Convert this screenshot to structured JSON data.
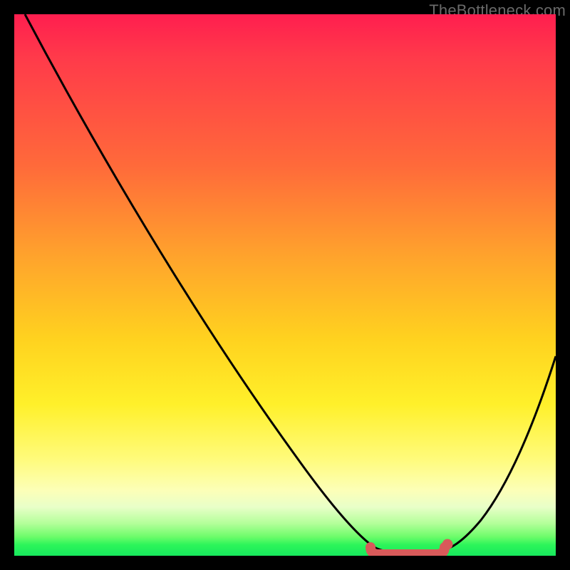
{
  "watermark": {
    "text": "TheBottleneck.com"
  },
  "colors": {
    "background": "#000000",
    "curve": "#000000",
    "marker_stroke": "#d85a5a",
    "marker_fill": "#d85a5a",
    "gradient_stops": [
      "#ff1e4f",
      "#ff3a4a",
      "#ff6a3a",
      "#ffa42c",
      "#ffd21f",
      "#fff02a",
      "#fffb7a",
      "#fcffb8",
      "#e8ffc8",
      "#b4ff9a",
      "#6dfc6a",
      "#2cf55a",
      "#17e85c"
    ]
  },
  "chart_data": {
    "type": "line",
    "title": "",
    "xlabel": "",
    "ylabel": "",
    "xlim": [
      0,
      100
    ],
    "ylim": [
      0,
      100
    ],
    "grid": false,
    "legend": false,
    "series": [
      {
        "name": "bottleneck-curve",
        "x": [
          2,
          10,
          20,
          30,
          40,
          50,
          58,
          62,
          66,
          70,
          73,
          76,
          80,
          85,
          90,
          95,
          100
        ],
        "y": [
          100,
          87,
          72,
          57,
          42,
          27,
          15,
          9,
          4,
          1,
          0,
          0,
          1,
          7,
          17,
          32,
          50
        ]
      }
    ],
    "annotations": [
      {
        "name": "optimal-zone-marker",
        "shape": "rounded-segment",
        "x_start": 66,
        "x_end": 80,
        "y": 0.5,
        "note": "flat bottom region highlighted in salmon"
      }
    ],
    "gradient_meaning": "vertical color gradient encodes bottleneck severity: red=high at top, green=none at bottom"
  }
}
